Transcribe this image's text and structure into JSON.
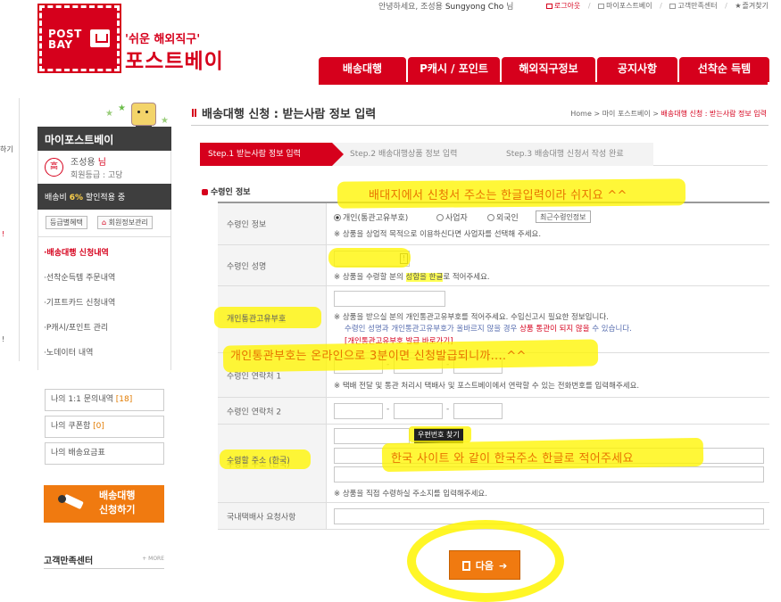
{
  "topbar": {
    "greeting": "안녕하세요, 조성용",
    "user_en": "Sungyong Cho",
    "honorific": "님",
    "logout": "로그아웃",
    "mypage": "마이포스트베이",
    "support": "고객만족센터",
    "favorite": "즐겨찾기"
  },
  "header": {
    "logo_text": "POST BAY",
    "tagline": "'쉬운 해외직구'",
    "brand": "포스트베이",
    "nav": [
      "배송대행",
      "P캐시 / 포인트",
      "해외직구정보",
      "공지사항",
      "선착순 득템"
    ]
  },
  "edge_fragments": [
    "하기",
    "!",
    "!"
  ],
  "sidebar": {
    "title": "마이포스트베이",
    "avatar": "高",
    "user_name": "조성용",
    "user_suffix": "님",
    "grade": "회원등급 : 고당",
    "discount_prefix": "배송비",
    "discount_value": "6%",
    "discount_suffix": "할인적용 중",
    "grade_benefit_btn": "등급별혜택",
    "member_info_btn": "회원정보관리",
    "menu": [
      "배송대행 신청내역",
      "선착순득템 주문내역",
      "기프트카드 신청내역",
      "P캐시/포인트 관리",
      "노데이터 내역"
    ],
    "inquiry_label": "나의 1:1 문의내역",
    "inquiry_count": "[18]",
    "coupon_label": "나의 쿠폰함",
    "coupon_count": "[0]",
    "fee_table": "나의 배송요금표",
    "cta_line1": "배송대행",
    "cta_line2": "신청하기",
    "cs_title": "고객만족센터",
    "cs_more": "+ MORE"
  },
  "page": {
    "title": "배송대행 신청 : 받는사람 정보 입력",
    "breadcrumb": [
      "Home",
      "마이 포스트베이",
      "배송대행 신청 : 받는사람 정보 입력"
    ],
    "steps": [
      "Step.1 받는사람 정보 입력",
      "Step.2 배송대행상품 정보 입력",
      "Step.3 배송대행 신청서 작성 완료"
    ],
    "section_title": "수령인 정보"
  },
  "form": {
    "recipient_info": {
      "label": "수령인 정보",
      "options": [
        "개인(통관고유부호)",
        "사업자",
        "외국인"
      ],
      "selected": "개인(통관고유부호)",
      "recent_btn": "최근수령인정보",
      "note": "※ 상품을 상업적 목적으로 이용하신다면 사업자를 선택해 주세요."
    },
    "recipient_name": {
      "label": "수령인 성명",
      "note_pre": "※ 상품을 수령할 분의 ",
      "note_hl": "성함을 한글",
      "note_post": "로 적어주세요."
    },
    "customs_code": {
      "label": "개인통관고유부호",
      "note1": "※ 상품을 받으실 분의 개인통관고유부호를 적어주세요. 수입신고시 필요한 정보입니다.",
      "note2_pre": "수령인 성명과 개인통관고유부호가 올바르지 않을 경우 ",
      "note2_red": "상품 통관이 되지 않을",
      "note2_post": " 수 있습니다.",
      "link": "[개인통관고유부호 발급 바로가기]"
    },
    "phone1": {
      "label": "수령인 연락처 1",
      "note": "※ 택배 전달 및 통관 처리시 택배사 및 포스트베이에서 연락할 수 있는 전화번호를 입력해주세요."
    },
    "phone2": {
      "label": "수령인 연락처 2"
    },
    "address": {
      "label": "수령할 주소 (한국)",
      "zip_btn": "우편번호 찾기",
      "note": "※ 상품을 직접 수령하실 주소지를 입력해주세요."
    },
    "courier_request": {
      "label": "국내택배사 요청사항"
    }
  },
  "annotations": {
    "a1": "배대지에서 신청서 주소는 한글입력이라 쉬지요 ^^",
    "a2": "개인통관부호는 온라인으로 3분이면 신청발급되니까....^^",
    "a3": "한국 사이트 와 같이 한국주소 한글로 적어주세요"
  },
  "next_btn": "다음",
  "colors": {
    "brand_red": "#d6001c",
    "accent_orange": "#f07a10",
    "highlight_yellow": "#fff500"
  }
}
